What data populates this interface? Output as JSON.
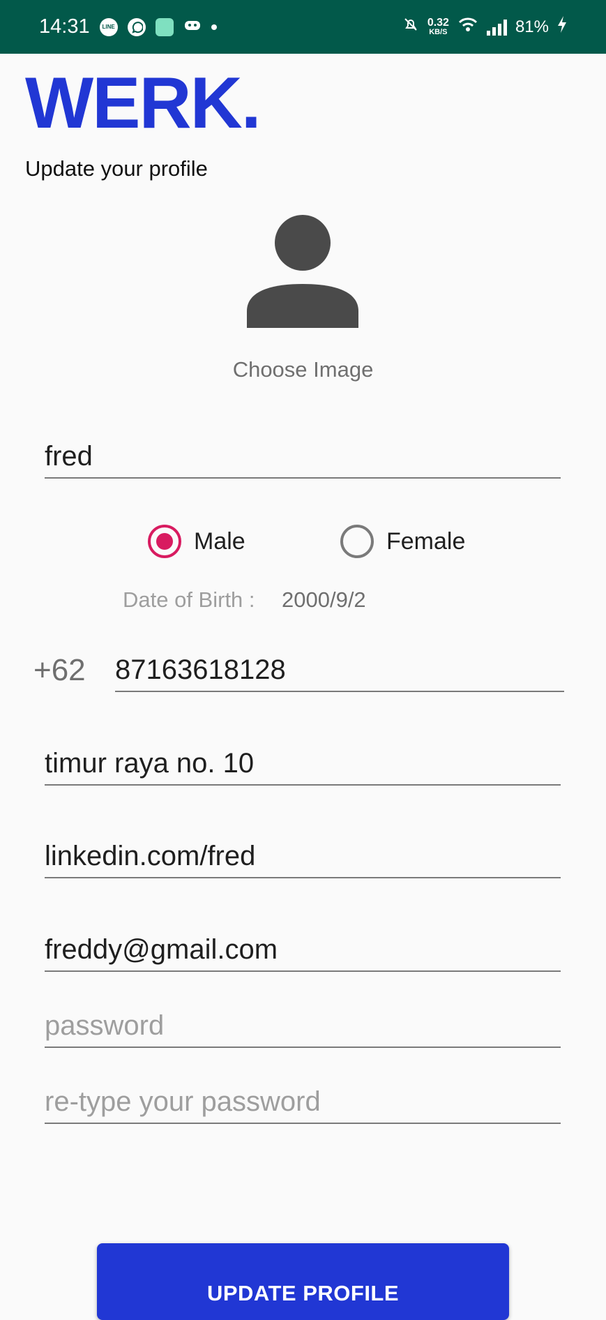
{
  "status_bar": {
    "time": "14:31",
    "app_icons": [
      "line-icon",
      "whatsapp-icon",
      "app-icon",
      "game-icon"
    ],
    "net_speed_value": "0.32",
    "net_speed_unit": "KB/S",
    "battery": "81%"
  },
  "header": {
    "logo": "WERK.",
    "subtitle": "Update your profile"
  },
  "avatar": {
    "choose_image_label": "Choose Image"
  },
  "form": {
    "name": "fred",
    "gender": {
      "options": [
        "Male",
        "Female"
      ],
      "selected": "Male"
    },
    "dob_label": "Date of Birth :",
    "dob_value": "2000/9/2",
    "phone_prefix": "+62",
    "phone": "87163618128",
    "address": "timur raya no. 10",
    "linkedin": "linkedin.com/fred",
    "email": "freddy@gmail.com",
    "password_placeholder": "password",
    "retype_password_placeholder": "re-type your password"
  },
  "actions": {
    "update_label": "UPDATE PROFILE"
  },
  "colors": {
    "brand": "#2137d4",
    "status_bar": "#02594a",
    "radio_accent": "#d81b60"
  }
}
